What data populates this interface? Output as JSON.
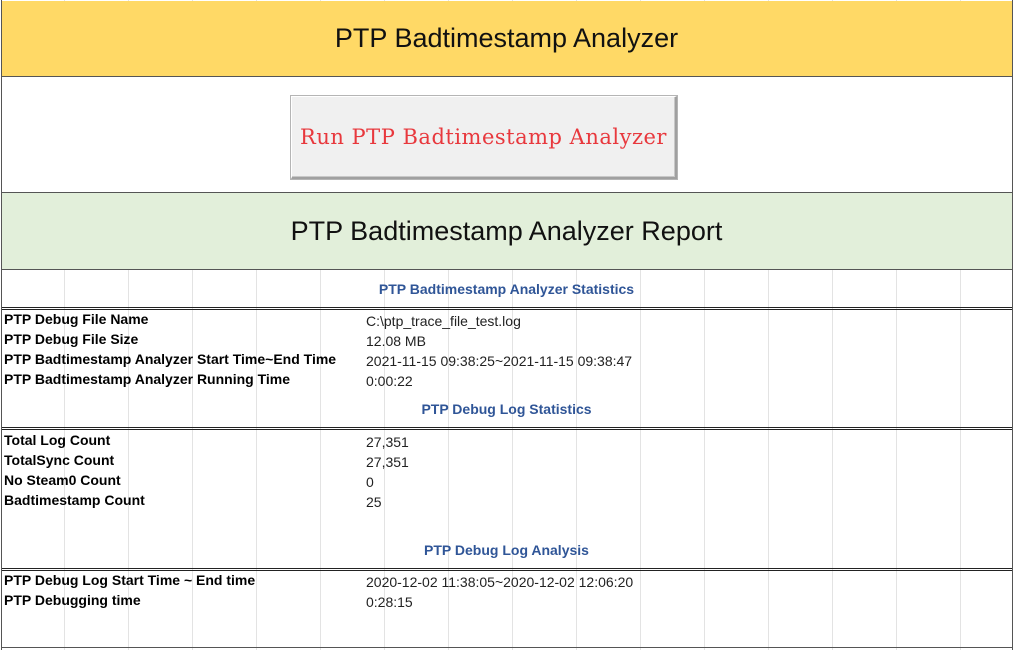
{
  "header": {
    "title": "PTP Badtimestamp Analyzer"
  },
  "run_button": {
    "label": "Run PTP Badtimestamp Analyzer"
  },
  "report": {
    "title": "PTP Badtimestamp Analyzer Report"
  },
  "sections": {
    "analyzer_statistics": {
      "heading": "PTP Badtimestamp Analyzer Statistics",
      "rows": [
        {
          "label": "PTP Debug File Name",
          "value": "C:\\ptp_trace_file_test.log"
        },
        {
          "label": "PTP Debug File Size",
          "value": "12.08 MB"
        },
        {
          "label": "PTP Badtimestamp Analyzer Start Time~End Time",
          "value": "2021-11-15 09:38:25~2021-11-15 09:38:47"
        },
        {
          "label": "PTP Badtimestamp Analyzer Running Time",
          "value": "0:00:22"
        }
      ]
    },
    "log_statistics": {
      "heading": "PTP Debug Log Statistics",
      "rows": [
        {
          "label": "Total Log Count",
          "value": "27,351"
        },
        {
          "label": "TotalSync Count",
          "value": "27,351"
        },
        {
          "label": "No Steam0 Count",
          "value": "0"
        },
        {
          "label": "Badtimestamp Count",
          "value": "25"
        }
      ]
    },
    "log_analysis": {
      "heading": "PTP Debug Log Analysis",
      "rows": [
        {
          "label": "PTP Debug Log Start Time ~ End time",
          "value": "2020-12-02 11:38:05~2020-12-02 12:06:20"
        },
        {
          "label": "PTP Debugging time",
          "value": "0:28:15"
        }
      ]
    }
  },
  "colors": {
    "title_band": "#ffd966",
    "report_band": "#e2efda",
    "button_text": "#e8383d",
    "section_heading": "#2f5597"
  }
}
